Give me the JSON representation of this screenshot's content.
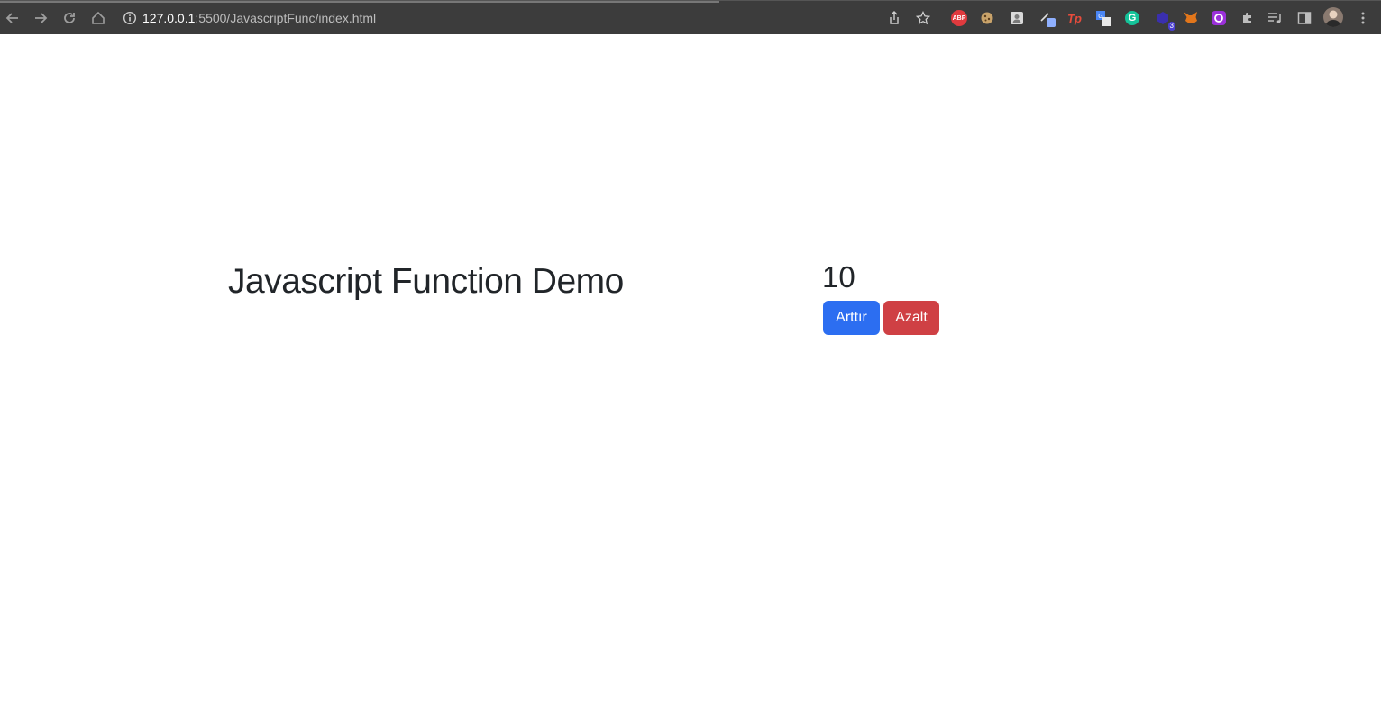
{
  "browser": {
    "url_host": "127.0.0.1",
    "url_rest": ":5500/JavascriptFunc/index.html",
    "extensions": [
      {
        "icon": "adblock-plus-icon",
        "label": "ABP"
      },
      {
        "icon": "cookie-icon"
      },
      {
        "icon": "contacts-icon"
      },
      {
        "icon": "pen-tool-icon"
      },
      {
        "icon": "tp-icon",
        "label": "Tp"
      },
      {
        "icon": "translate-icon"
      },
      {
        "icon": "grammarly-icon",
        "label": "G"
      },
      {
        "icon": "cube-icon",
        "badge": "3"
      },
      {
        "icon": "metamask-fox-icon"
      },
      {
        "icon": "purple-shield-icon"
      }
    ]
  },
  "main": {
    "heading": "Javascript Function Demo",
    "counter": "10",
    "increment_label": "Arttır",
    "decrement_label": "Azalt"
  },
  "colors": {
    "primary": "#2c6ef1",
    "danger": "#cf4044",
    "text": "#212529",
    "toolbar": "#3c3c3c"
  }
}
